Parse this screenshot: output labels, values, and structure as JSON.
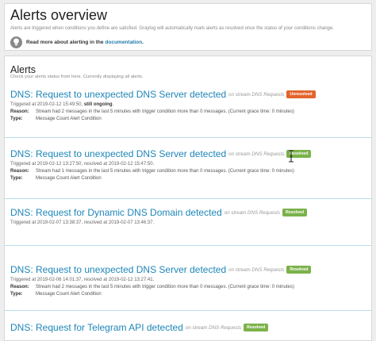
{
  "overview": {
    "title": "Alerts overview",
    "description": "Alerts are triggered when conditions you define are satisfied. Graylog will automatically mark alerts as resolved once the status of your conditions change.",
    "hint_text": "Read more about alerting in the",
    "hint_link": "documentation",
    "hint_end": "."
  },
  "alerts_panel": {
    "title": "Alerts",
    "description": "Check your alerts status from here. Currently displaying all alerts.",
    "on_stream_prefix": "on stream",
    "reason_label": "Reason:",
    "type_label": "Type:",
    "items": [
      {
        "title": "DNS: Request to unexpected DNS Server detected",
        "stream": "DNS Requests",
        "status": "Unresolved",
        "triggered": "Triggered at 2019-02-12 15:49:50, ",
        "triggered_strong": "still ongoing",
        "triggered_end": ".",
        "reason": "Stream had 2 messages in the last 5 minutes with trigger condition more than 0 messages. (Current grace time: 0 minutes)",
        "type": "Message Count Alert Condition"
      },
      {
        "title": "DNS: Request to unexpected DNS Server detected",
        "stream": "DNS Requests",
        "status": "Resolved",
        "triggered": "Triggered at 2019-02-12 13:27:50, resolved at 2019-02-12 15:47:50.",
        "triggered_strong": "",
        "triggered_end": "",
        "reason": "Stream had 1 messages in the last 5 minutes with trigger condition more than 0 messages. (Current grace time: 0 minutes)",
        "type": "Message Count Alert Condition"
      },
      {
        "title": "DNS: Request for Dynamic DNS Domain detected",
        "stream": "DNS Requests",
        "status": "Resolved",
        "triggered": "Triggered at 2019-02-07 13:38:37, resolved at 2019-02-07 13:46:37.",
        "triggered_strong": "",
        "triggered_end": "",
        "reason": "",
        "type": ""
      },
      {
        "title": "DNS: Request to unexpected DNS Server detected",
        "stream": "DNS Requests",
        "status": "Resolved",
        "triggered": "Triggered at 2019-02-06 14:01:37, resolved at 2019-02-12 13:27:41.",
        "triggered_strong": "",
        "triggered_end": "",
        "reason": "Stream had 2 messages in the last 5 minutes with trigger condition more than 0 messages. (Current grace time: 0 minutes)",
        "type": "Message Count Alert Condition"
      },
      {
        "title": "DNS: Request for Telegram API detected",
        "stream": "DNS Requests",
        "status": "Resolved",
        "triggered": "",
        "triggered_strong": "",
        "triggered_end": "",
        "reason": "",
        "type": ""
      }
    ]
  },
  "colors": {
    "link": "#1e86b8",
    "unresolved": "#e2642c",
    "resolved": "#7bb24a"
  },
  "icons": {
    "hint": "lightbulb-icon",
    "pointer": "text-cursor-icon"
  }
}
